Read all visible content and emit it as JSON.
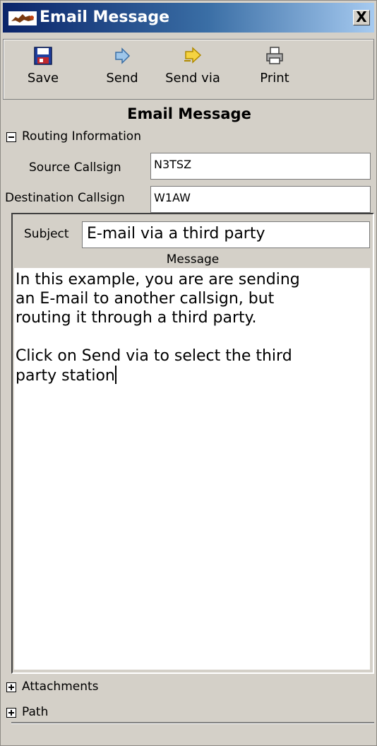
{
  "window": {
    "title": "Email Message",
    "close_label": "X",
    "icon": "app-logo-icon"
  },
  "toolbar": {
    "save_label": "Save",
    "send_label": "Send",
    "send_via_label": "Send via",
    "print_label": "Print",
    "icons": {
      "save": "save-disk-icon",
      "send": "send-arrow-icon",
      "send_via": "send-via-arrow-icon",
      "print": "printer-icon"
    }
  },
  "form": {
    "title": "Email Message",
    "routing": {
      "section_label": "Routing Information",
      "expanded": true,
      "source_label": "Source Callsign",
      "source_value": "N3TSZ",
      "destination_label": "Destination Callsign",
      "destination_value": "W1AW"
    },
    "subject_label": "Subject",
    "subject_value": "E-mail via a third party",
    "message_label": "Message",
    "message_value": "In this example, you are are sending\nan E-mail to another callsign, but\nrouting it through a third party.\n\nClick on Send via to select the third\nparty station",
    "attachments_label": "Attachments",
    "path_label": "Path"
  },
  "colors": {
    "title_gradient_start": "#0a246a",
    "title_gradient_end": "#a6caf0",
    "dialog_bg": "#d4d0c8",
    "send_icon": "#6fa8dc",
    "send_via_icon": "#f0c020",
    "save_icon": "#c0282d"
  }
}
